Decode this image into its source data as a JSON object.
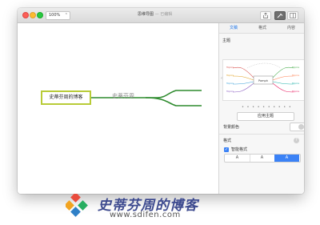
{
  "window": {
    "zoom": "100%",
    "title": "思维导图",
    "title_sep": " — ",
    "title_status": "已编辑"
  },
  "canvas": {
    "root_topic": "史蒂芬周的博客",
    "child_label": "史蒂芬周",
    "branch_color": "#2e8b2e",
    "root_border_color": "#b8cb37"
  },
  "sidebar": {
    "tabs": [
      "文稿",
      "格式",
      "内容"
    ],
    "active_tab": 0,
    "theme_section": "主题",
    "theme_preview": {
      "center": "Pomph",
      "left_topics": [
        "Topics",
        "Topics",
        "Topics",
        "Topics"
      ],
      "right_topics": [
        "Topics",
        "Topics",
        "Topics",
        "Topics"
      ]
    },
    "apply_theme": "应用主题",
    "background_label": "背景颜色",
    "style_section": "格式",
    "smart_style_label": "智能格式",
    "smart_style_checked": true,
    "segments": [
      "A",
      "A",
      "A"
    ]
  },
  "watermark": {
    "title": "史蒂芬周的博客",
    "url": "www.sdifen.com"
  }
}
